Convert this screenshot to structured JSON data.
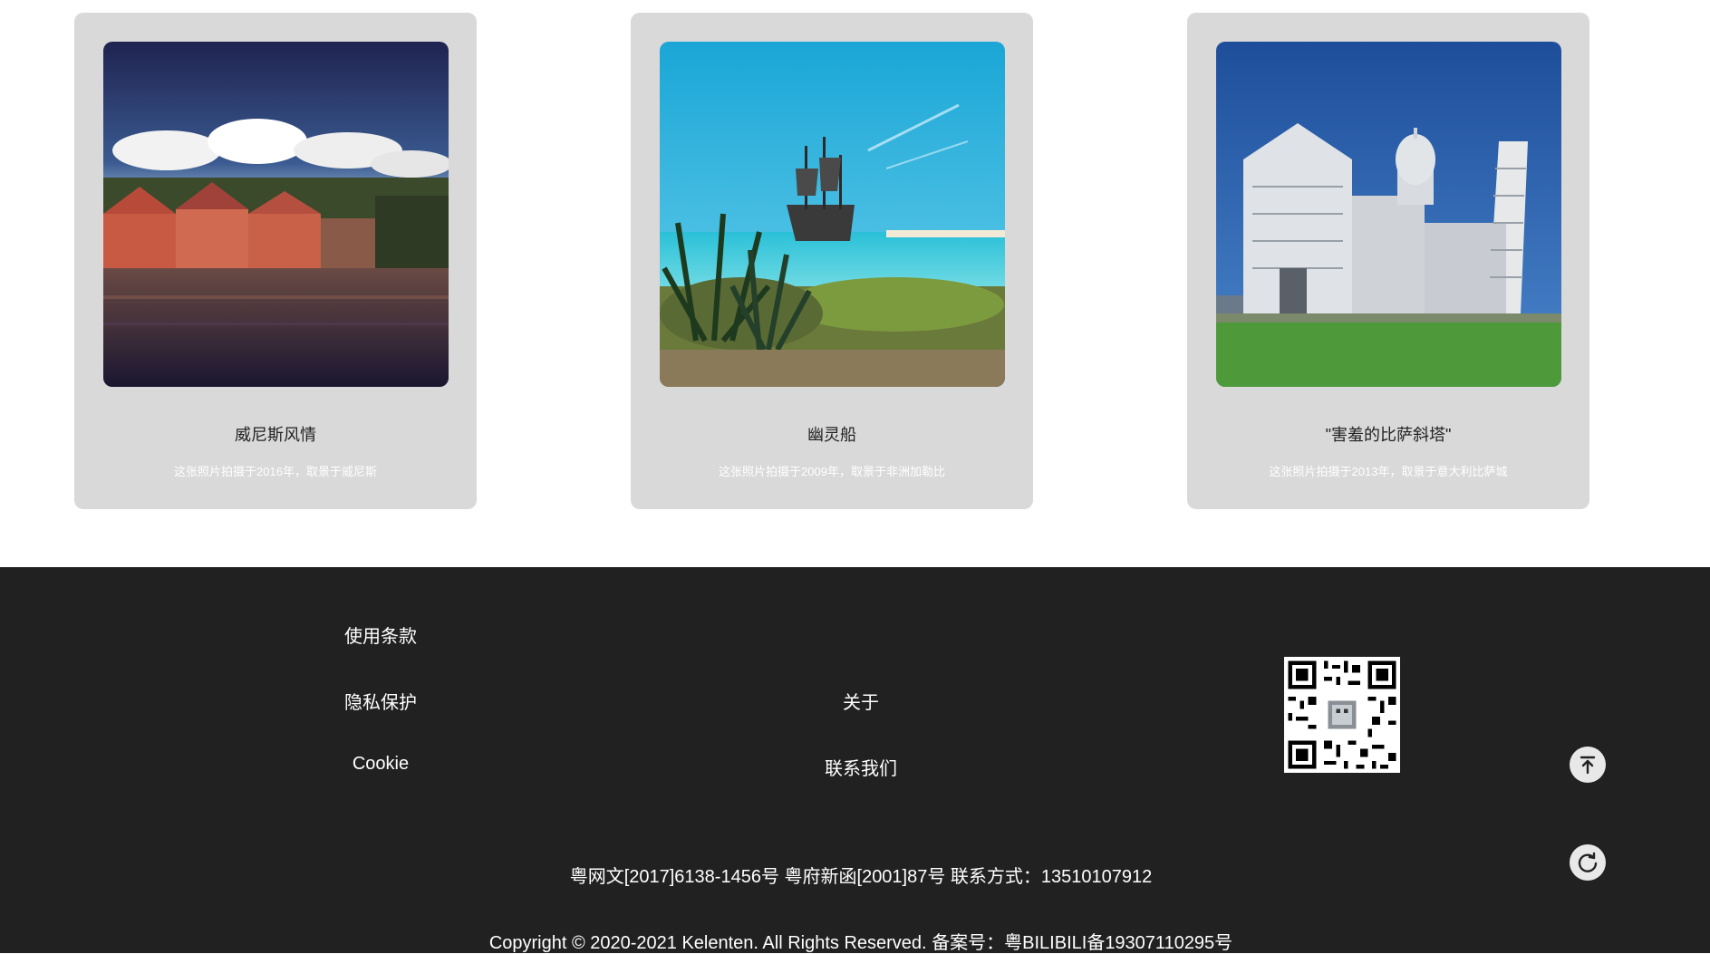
{
  "gallery": {
    "cards": [
      {
        "title": "威尼斯风情",
        "desc": "这张照片拍摄于2016年，取景于威尼斯",
        "image": "harbor-town-photo"
      },
      {
        "title": "幽灵船",
        "desc": "这张照片拍摄于2009年，取景于非洲加勒比",
        "image": "ghost-ship-photo"
      },
      {
        "title": "\"害羞的比萨斜塔\"",
        "desc": "这张照片拍摄于2013年，取景于意大利比萨城",
        "image": "pisa-cathedral-photo"
      }
    ]
  },
  "footer": {
    "links_col1": [
      "使用条款",
      "隐私保护",
      "Cookie"
    ],
    "links_col2": [
      "关于",
      "联系我们"
    ],
    "qr_icon": "qr-code-icon",
    "back_to_top_icon": "back-to-top-icon",
    "refresh_icon": "refresh-icon",
    "license_line": "粤网文[2017]6138-1456号 粤府新函[2001]87号 联系方式：13510107912",
    "copyright_line": "Copyright © 2020-2021 Kelenten. All Rights Reserved. 备案号：粤BILIBILI备19307110295号"
  },
  "colors": {
    "card_bg": "#d9d9d9",
    "footer_bg": "#212121",
    "button_bg": "#e8e8e8"
  }
}
